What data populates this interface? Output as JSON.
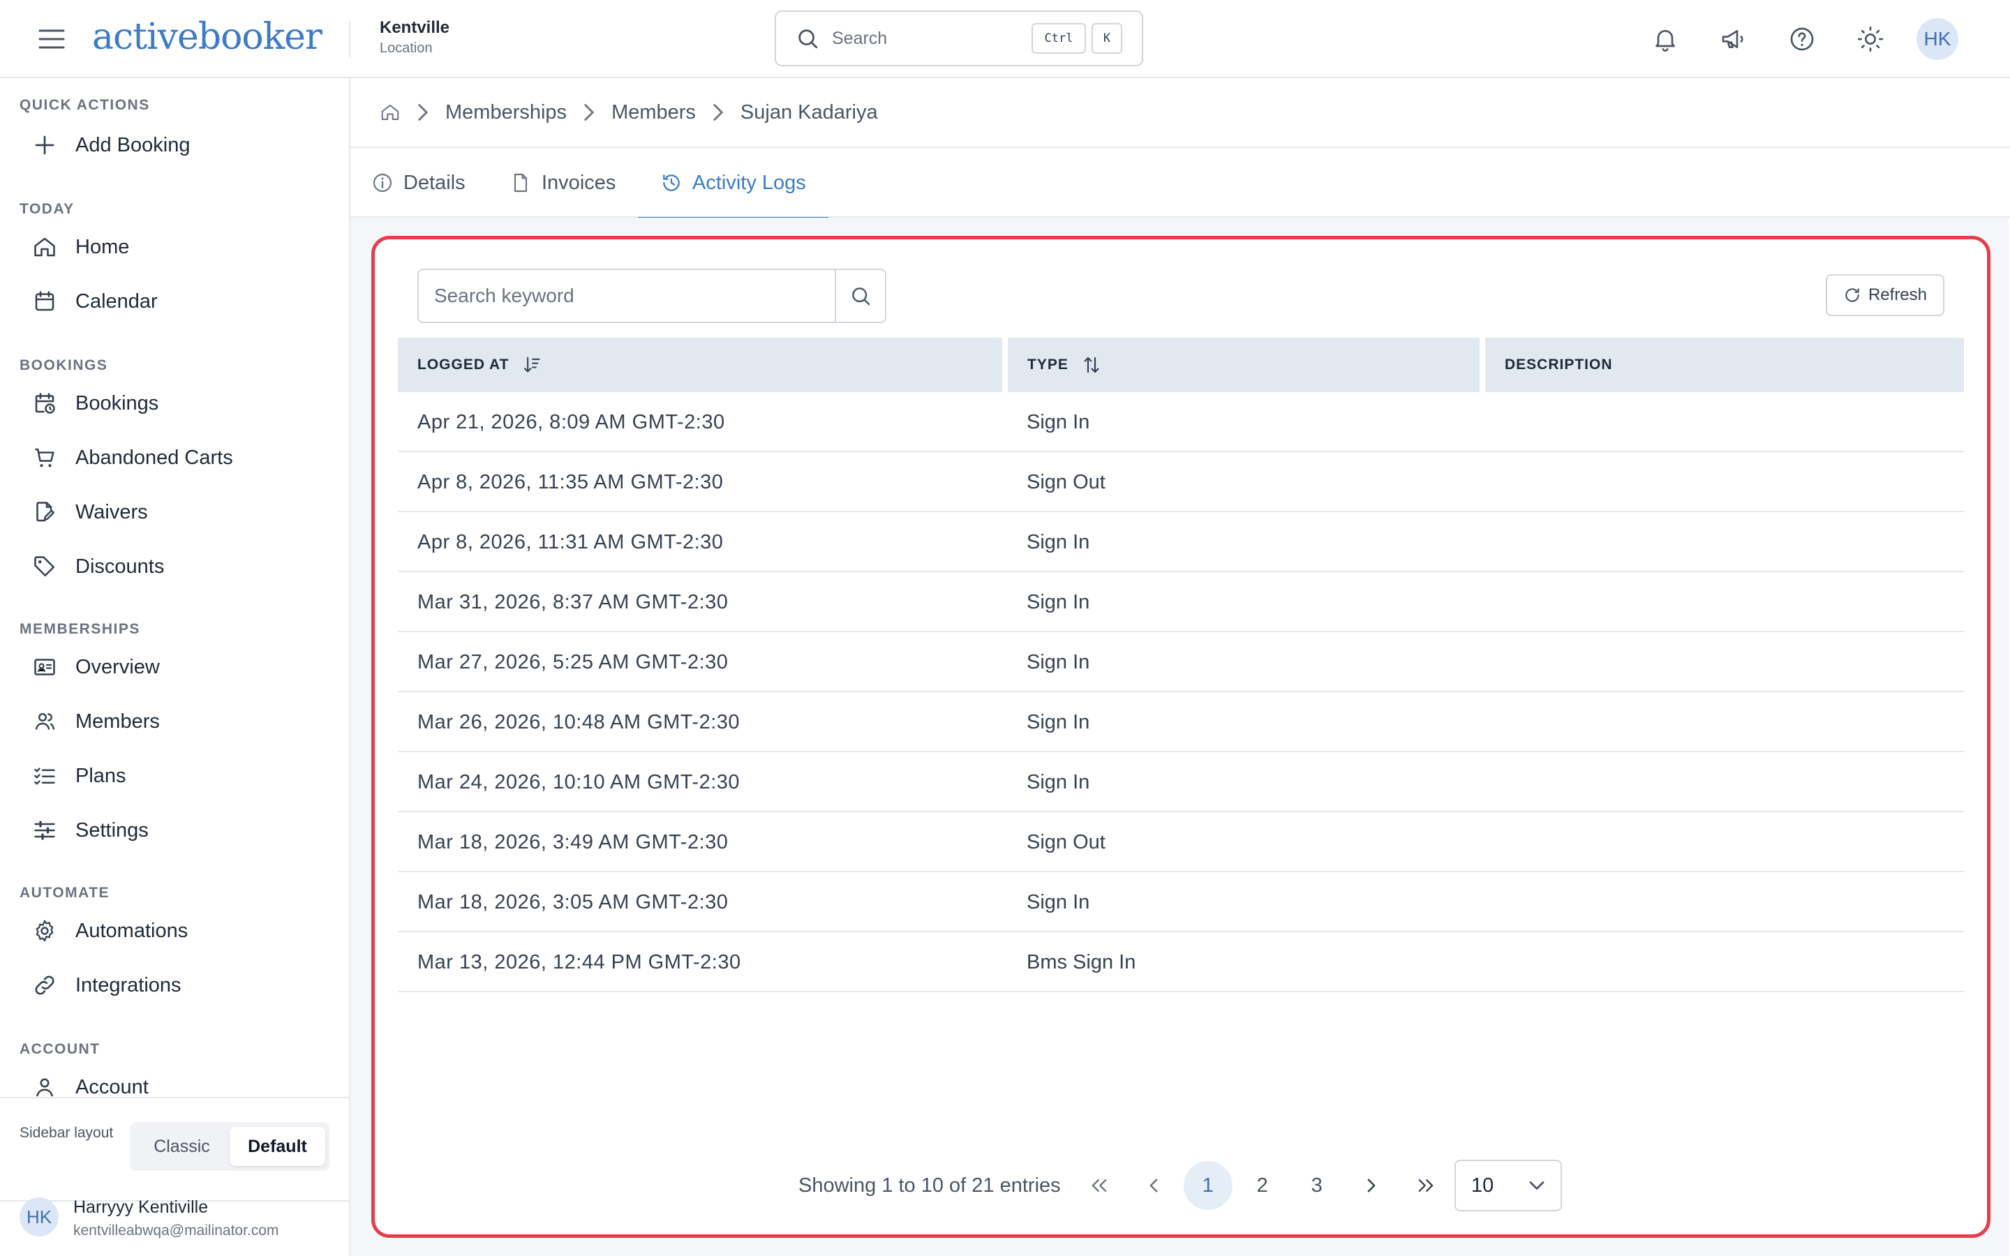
{
  "header": {
    "brand": "activebooker",
    "location_name": "Kentville",
    "location_label": "Location",
    "search_placeholder": "Search",
    "shortcut_ctrl": "Ctrl",
    "shortcut_key": "K",
    "avatar_initials": "HK",
    "icons": [
      "menu-icon",
      "bell-icon",
      "megaphone-icon",
      "help-icon",
      "sun-icon"
    ]
  },
  "sidebar": {
    "sections": [
      {
        "title": "QUICK ACTIONS",
        "items": [
          {
            "label": "Add Booking",
            "icon": "plus-icon"
          }
        ]
      },
      {
        "title": "TODAY",
        "items": [
          {
            "label": "Home",
            "icon": "home-icon"
          },
          {
            "label": "Calendar",
            "icon": "calendar-icon"
          }
        ]
      },
      {
        "title": "BOOKINGS",
        "items": [
          {
            "label": "Bookings",
            "icon": "calendar-clock-icon"
          },
          {
            "label": "Abandoned Carts",
            "icon": "cart-icon"
          },
          {
            "label": "Waivers",
            "icon": "document-edit-icon"
          },
          {
            "label": "Discounts",
            "icon": "tag-icon"
          }
        ]
      },
      {
        "title": "MEMBERSHIPS",
        "items": [
          {
            "label": "Overview",
            "icon": "id-card-icon"
          },
          {
            "label": "Members",
            "icon": "users-icon"
          },
          {
            "label": "Plans",
            "icon": "list-check-icon"
          },
          {
            "label": "Settings",
            "icon": "sliders-icon"
          }
        ]
      },
      {
        "title": "AUTOMATE",
        "items": [
          {
            "label": "Automations",
            "icon": "gear-icon"
          },
          {
            "label": "Integrations",
            "icon": "link-icon"
          }
        ]
      },
      {
        "title": "ACCOUNT",
        "items": [
          {
            "label": "Account",
            "icon": "user-icon"
          }
        ]
      }
    ],
    "layout_label": "Sidebar layout",
    "layout_options": [
      "Classic",
      "Default"
    ],
    "layout_selected": "Default",
    "user": {
      "initials": "HK",
      "name": "Harryyy Kentiville",
      "email": "kentvilleabwqa@mailinator.com"
    }
  },
  "breadcrumb": [
    "Memberships",
    "Members",
    "Sujan Kadariya"
  ],
  "tabs": [
    {
      "label": "Details",
      "icon": "info-icon",
      "active": false
    },
    {
      "label": "Invoices",
      "icon": "file-icon",
      "active": false
    },
    {
      "label": "Activity Logs",
      "icon": "history-icon",
      "active": true
    }
  ],
  "activity": {
    "search_placeholder": "Search keyword",
    "refresh_label": "Refresh",
    "columns": [
      "LOGGED AT",
      "TYPE",
      "DESCRIPTION"
    ],
    "rows": [
      {
        "logged_at": "Apr 21, 2026, 8:09 AM GMT-2:30",
        "type": "Sign In",
        "description": ""
      },
      {
        "logged_at": "Apr 8, 2026, 11:35 AM GMT-2:30",
        "type": "Sign Out",
        "description": ""
      },
      {
        "logged_at": "Apr 8, 2026, 11:31 AM GMT-2:30",
        "type": "Sign In",
        "description": ""
      },
      {
        "logged_at": "Mar 31, 2026, 8:37 AM GMT-2:30",
        "type": "Sign In",
        "description": ""
      },
      {
        "logged_at": "Mar 27, 2026, 5:25 AM GMT-2:30",
        "type": "Sign In",
        "description": ""
      },
      {
        "logged_at": "Mar 26, 2026, 10:48 AM GMT-2:30",
        "type": "Sign In",
        "description": ""
      },
      {
        "logged_at": "Mar 24, 2026, 10:10 AM GMT-2:30",
        "type": "Sign In",
        "description": ""
      },
      {
        "logged_at": "Mar 18, 2026, 3:49 AM GMT-2:30",
        "type": "Sign Out",
        "description": ""
      },
      {
        "logged_at": "Mar 18, 2026, 3:05 AM GMT-2:30",
        "type": "Sign In",
        "description": ""
      },
      {
        "logged_at": "Mar 13, 2026, 12:44 PM GMT-2:30",
        "type": "Bms Sign In",
        "description": ""
      }
    ],
    "pagination": {
      "info": "Showing 1 to 10 of 21 entries",
      "pages": [
        "1",
        "2",
        "3"
      ],
      "current_page": "1",
      "page_size": "10"
    }
  },
  "colors": {
    "accent": "#3b7bc8",
    "highlight_border": "#e53e4a",
    "table_header_bg": "#e2e8f0"
  }
}
